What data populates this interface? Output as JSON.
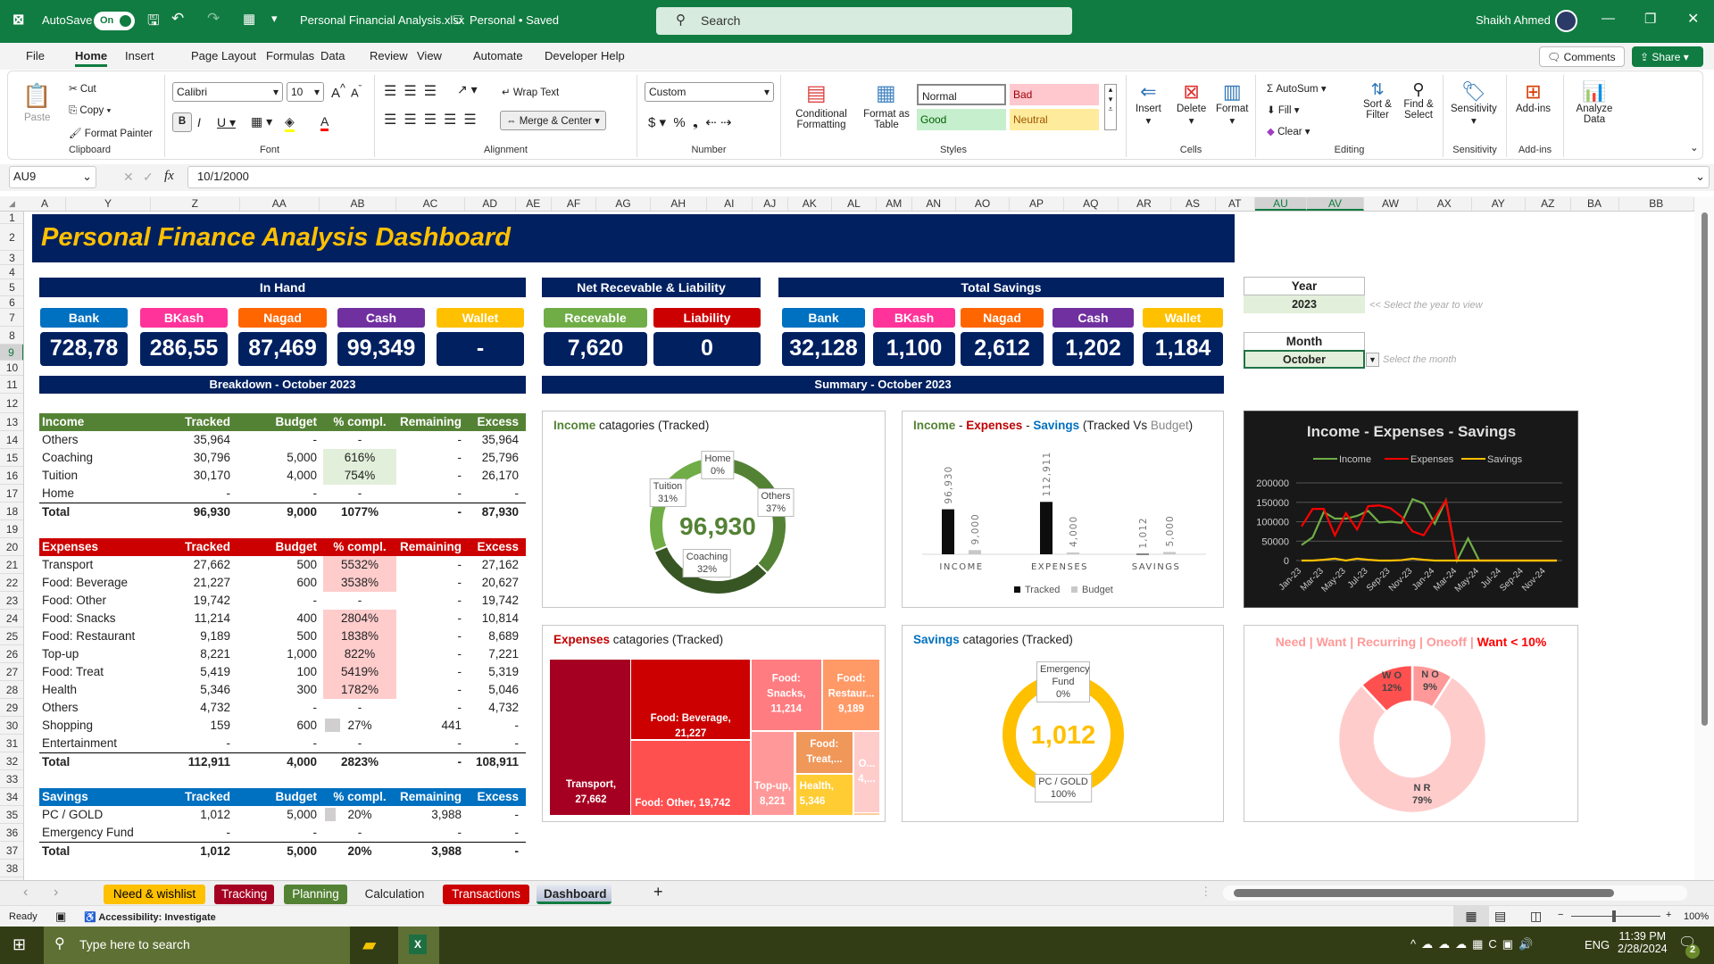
{
  "titlebar": {
    "autosave_label": "AutoSave",
    "autosave_state": "On",
    "filename": "Personal Financial Analysis.xlsx",
    "status": "Personal • Saved",
    "search_placeholder": "Search",
    "user": "Shaikh Ahmed"
  },
  "menu": {
    "tabs": [
      "File",
      "Home",
      "Insert",
      "Page Layout",
      "Formulas",
      "Data",
      "Review",
      "View",
      "Automate",
      "Developer",
      "Help"
    ],
    "active": "Home",
    "comments": "Comments",
    "share": "Share"
  },
  "ribbon": {
    "clipboard": {
      "label": "Clipboard",
      "paste": "Paste",
      "cut": "Cut",
      "copy": "Copy",
      "format_painter": "Format Painter"
    },
    "font": {
      "label": "Font",
      "name": "Calibri",
      "size": "10"
    },
    "alignment": {
      "label": "Alignment",
      "wrap": "Wrap Text",
      "merge": "Merge & Center"
    },
    "number": {
      "label": "Number",
      "format": "Custom"
    },
    "styles": {
      "label": "Styles",
      "conditional": "Conditional Formatting",
      "format_table": "Format as Table",
      "normal": "Normal",
      "bad": "Bad",
      "good": "Good",
      "neutral": "Neutral"
    },
    "cells": {
      "label": "Cells",
      "insert": "Insert",
      "delete": "Delete",
      "format": "Format"
    },
    "editing": {
      "label": "Editing",
      "autosum": "AutoSum",
      "fill": "Fill",
      "clear": "Clear",
      "sort": "Sort & Filter",
      "find": "Find & Select"
    },
    "sensitivity": {
      "label": "Sensitivity",
      "btn": "Sensitivity"
    },
    "addins": {
      "label": "Add-ins",
      "btn": "Add-ins"
    },
    "analyze": {
      "btn": "Analyze Data"
    }
  },
  "formula_bar": {
    "name_box": "AU9",
    "fx": "fx",
    "value": "10/1/2000"
  },
  "columns": [
    "A",
    "Y",
    "Z",
    "AA",
    "AB",
    "AC",
    "AD",
    "AE",
    "AF",
    "AG",
    "AH",
    "AI",
    "AJ",
    "AK",
    "AL",
    "AM",
    "AN",
    "AO",
    "AP",
    "AQ",
    "AR",
    "AS",
    "AT",
    "AU",
    "AV",
    "AW",
    "AX",
    "AY",
    "AZ",
    "BA",
    "BB"
  ],
  "selected_columns": [
    "AU",
    "AV"
  ],
  "rows": [
    "1",
    "2",
    "3",
    "4",
    "5",
    "6",
    "7",
    "8",
    "9",
    "10",
    "11",
    "12",
    "13",
    "14",
    "15",
    "16",
    "17",
    "18",
    "19",
    "20",
    "21",
    "22",
    "23",
    "24",
    "25",
    "26",
    "27",
    "28",
    "29",
    "30",
    "31",
    "32",
    "33",
    "34",
    "35",
    "36",
    "37",
    "38"
  ],
  "dashboard": {
    "title": "Personal Finance Analysis Dashboard",
    "in_hand": {
      "header": "In Hand",
      "items": [
        {
          "label": "Bank",
          "value": "728,78",
          "color": "#0070C0"
        },
        {
          "label": "BKash",
          "value": "286,55",
          "color": "#FF3399"
        },
        {
          "label": "Nagad",
          "value": "87,469",
          "color": "#FF6600"
        },
        {
          "label": "Cash",
          "value": "99,349",
          "color": "#7030A0"
        },
        {
          "label": "Wallet",
          "value": "-",
          "color": "#FFC000"
        }
      ]
    },
    "net": {
      "header": "Net Recevable & Liability",
      "items": [
        {
          "label": "Recevable",
          "value": "7,620",
          "color": "#70AD47"
        },
        {
          "label": "Liability",
          "value": "0",
          "color": "#CC0000"
        }
      ]
    },
    "savings": {
      "header": "Total Savings",
      "items": [
        {
          "label": "Bank",
          "value": "32,128",
          "color": "#0070C0"
        },
        {
          "label": "BKash",
          "value": "1,100",
          "color": "#FF3399"
        },
        {
          "label": "Nagad",
          "value": "2,612",
          "color": "#FF6600"
        },
        {
          "label": "Cash",
          "value": "1,202",
          "color": "#7030A0"
        },
        {
          "label": "Wallet",
          "value": "1,184",
          "color": "#FFC000"
        }
      ]
    },
    "breakdown_header": "Breakdown - October 2023",
    "summary_header": "Summary - October 2023",
    "year": {
      "label": "Year",
      "value": "2023",
      "hint": "<< Select the year to view"
    },
    "month": {
      "label": "Month",
      "value": "October",
      "hint": "Select the month"
    }
  },
  "tables": {
    "income": {
      "color": "#548235",
      "header": [
        "Income",
        "Tracked",
        "Budget",
        "% compl.",
        "Remaining",
        "Excess"
      ],
      "rows": [
        [
          "Others",
          "35,964",
          "-",
          "-",
          "-",
          "35,964"
        ],
        [
          "Coaching",
          "30,796",
          "5,000",
          "616%",
          "-",
          "25,796"
        ],
        [
          "Tuition",
          "30,170",
          "4,000",
          "754%",
          "-",
          "26,170"
        ],
        [
          "Home",
          "-",
          "-",
          "-",
          "-",
          "-"
        ]
      ],
      "total": [
        "Total",
        "96,930",
        "9,000",
        "1077%",
        "-",
        "87,930"
      ]
    },
    "expenses": {
      "color": "#CC0000",
      "header": [
        "Expenses",
        "Tracked",
        "Budget",
        "% compl.",
        "Remaining",
        "Excess"
      ],
      "rows": [
        [
          "Transport",
          "27,662",
          "500",
          "5532%",
          "-",
          "27,162"
        ],
        [
          "Food: Beverage",
          "21,227",
          "600",
          "3538%",
          "-",
          "20,627"
        ],
        [
          "Food: Other",
          "19,742",
          "-",
          "-",
          "-",
          "19,742"
        ],
        [
          "Food: Snacks",
          "11,214",
          "400",
          "2804%",
          "-",
          "10,814"
        ],
        [
          "Food: Restaurant",
          "9,189",
          "500",
          "1838%",
          "-",
          "8,689"
        ],
        [
          "Top-up",
          "8,221",
          "1,000",
          "822%",
          "-",
          "7,221"
        ],
        [
          "Food: Treat",
          "5,419",
          "100",
          "5419%",
          "-",
          "5,319"
        ],
        [
          "Health",
          "5,346",
          "300",
          "1782%",
          "-",
          "5,046"
        ],
        [
          "Others",
          "4,732",
          "-",
          "-",
          "-",
          "4,732"
        ],
        [
          "Shopping",
          "159",
          "600",
          "27%",
          "441",
          "-"
        ],
        [
          "Entertainment",
          "-",
          "-",
          "-",
          "-",
          "-"
        ]
      ],
      "total": [
        "Total",
        "112,911",
        "4,000",
        "2823%",
        "-",
        "108,911"
      ]
    },
    "savings": {
      "color": "#0070C0",
      "header": [
        "Savings",
        "Tracked",
        "Budget",
        "% compl.",
        "Remaining",
        "Excess"
      ],
      "rows": [
        [
          "PC / GOLD",
          "1,012",
          "5,000",
          "20%",
          "3,988",
          "-"
        ],
        [
          "Emergency Fund",
          "-",
          "-",
          "-",
          "-",
          "-"
        ]
      ],
      "total": [
        "Total",
        "1,012",
        "5,000",
        "20%",
        "3,988",
        "-"
      ]
    }
  },
  "chart_data": [
    {
      "type": "pie",
      "id": "income-donut",
      "title_parts": [
        "Income",
        " catagories (Tracked)"
      ],
      "center_value": "96,930",
      "slices": [
        {
          "name": "Others",
          "value": 35964,
          "pct": "37%",
          "color": "#548235"
        },
        {
          "name": "Coaching",
          "value": 30796,
          "pct": "32%",
          "color": "#375623"
        },
        {
          "name": "Tuition",
          "value": 30170,
          "pct": "31%",
          "color": "#70AD47"
        },
        {
          "name": "Home",
          "value": 0,
          "pct": "0%",
          "color": "#A9D08E"
        }
      ]
    },
    {
      "type": "bar",
      "id": "ies-bars",
      "title_parts": [
        "Income",
        " - ",
        "Expenses",
        " - ",
        "Savings",
        " (",
        "Tracked",
        " Vs ",
        "Budget",
        ")"
      ],
      "categories": [
        "INCOME",
        "EXPENSES",
        "SAVINGS"
      ],
      "series": [
        {
          "name": "Tracked",
          "values": [
            96930,
            112911,
            1012
          ],
          "labels": [
            "96,930",
            "112,911",
            "1,012"
          ],
          "color": "#0d0d0d"
        },
        {
          "name": "Budget",
          "values": [
            9000,
            4000,
            5000
          ],
          "labels": [
            "9,000",
            "4,000",
            "5,000"
          ],
          "color": "#c8c8c8"
        }
      ],
      "ylim": [
        0,
        250000
      ]
    },
    {
      "type": "line",
      "id": "ies-trend",
      "title": "Income - Expenses - Savings",
      "x": [
        "Jan-23",
        "Feb-23",
        "Mar-23",
        "Apr-23",
        "May-23",
        "Jun-23",
        "Jul-23",
        "Aug-23",
        "Sep-23",
        "Oct-23",
        "Nov-23",
        "Dec-23",
        "Jan-24",
        "Feb-24",
        "Mar-24",
        "Apr-24",
        "May-24",
        "Jun-24",
        "Jul-24",
        "Aug-24",
        "Sep-24",
        "Oct-24",
        "Nov-24",
        "Dec-24"
      ],
      "xticks": [
        "Jan-23",
        "Mar-23",
        "May-23",
        "Jul-23",
        "Sep-23",
        "Nov-23",
        "Jan-24",
        "Mar-24",
        "May-24",
        "Jul-24",
        "Sep-24",
        "Nov-24"
      ],
      "series": [
        {
          "name": "Income",
          "color": "#70AD47",
          "values": [
            40000,
            60000,
            125000,
            108000,
            108000,
            115000,
            128000,
            98000,
            100000,
            96930,
            158000,
            147000,
            95000,
            155000,
            0,
            57000,
            0,
            0,
            0,
            0,
            0,
            0,
            0,
            0
          ]
        },
        {
          "name": "Expenses",
          "color": "#FF0000",
          "values": [
            88000,
            133000,
            133000,
            65000,
            122000,
            80000,
            140000,
            142000,
            135000,
            112911,
            75000,
            65000,
            110000,
            155000,
            0,
            0,
            0,
            0,
            0,
            0,
            0,
            0,
            0,
            0
          ]
        },
        {
          "name": "Savings",
          "color": "#FFC000",
          "values": [
            0,
            0,
            2000,
            5000,
            0,
            5000,
            2000,
            0,
            0,
            1012,
            5000,
            2000,
            0,
            0,
            0,
            0,
            0,
            0,
            0,
            0,
            0,
            0,
            0,
            0
          ]
        }
      ],
      "yticks": [
        "0",
        "50000",
        "100000",
        "150000",
        "200000"
      ],
      "ylim": [
        0,
        200000
      ],
      "grid": true,
      "legend": "top"
    },
    {
      "type": "treemap",
      "id": "expense-treemap",
      "title_parts": [
        "Expenses",
        " catagories (Tracked)"
      ],
      "items": [
        {
          "name": "Transport",
          "value": 27662,
          "label": "Transport, 27,662",
          "color": "#A50021"
        },
        {
          "name": "Food: Beverage",
          "value": 21227,
          "label": "Food: Beverage, 21,227",
          "color": "#CC0000"
        },
        {
          "name": "Food: Other",
          "value": 19742,
          "label": "Food: Other,  19,742",
          "color": "#FF5050"
        },
        {
          "name": "Food: Snacks",
          "value": 11214,
          "label": "Food: Snacks, 11,214",
          "color": "#FF7C80"
        },
        {
          "name": "Food: Restaurant",
          "value": 9189,
          "label": "Food: Restaur... 9,189",
          "color": "#FF9966"
        },
        {
          "name": "Top-up",
          "value": 8221,
          "label": "Top-up, 8,221",
          "color": "#FF9999"
        },
        {
          "name": "Food: Treat",
          "value": 5419,
          "label": "Food: Treat,...",
          "color": "#F0975A"
        },
        {
          "name": "Health",
          "value": 5346,
          "label": "Health, 5,346",
          "color": "#FFCC33"
        },
        {
          "name": "Others",
          "value": 4732,
          "label": "O... 4,...",
          "color": "#FFCCCC"
        },
        {
          "name": "Shopping",
          "value": 159,
          "label": "",
          "color": "#FFCC99"
        }
      ]
    },
    {
      "type": "pie",
      "id": "savings-donut",
      "title_parts": [
        "Savings",
        " catagories (Tracked)"
      ],
      "center_value": "1,012",
      "slices": [
        {
          "name": "Emergency Fund",
          "value": 0,
          "pct": "0%",
          "color": "#FFC000"
        },
        {
          "name": "PC / GOLD",
          "value": 1012,
          "pct": "100%",
          "color": "#FFC000"
        }
      ]
    },
    {
      "type": "pie",
      "id": "need-want-donut",
      "title_parts": [
        "Need | Want | Recurring | Oneoff | ",
        "Want < 10%"
      ],
      "slices": [
        {
          "name": "N O",
          "value": 9,
          "pct": "9%",
          "color": "#FF9999"
        },
        {
          "name": "N R",
          "value": 79,
          "pct": "79%",
          "color": "#FFCCCC"
        },
        {
          "name": "W O",
          "value": 12,
          "pct": "12%",
          "color": "#FF5050"
        }
      ]
    }
  ],
  "sheet_tabs": [
    {
      "label": "Need & wishlist",
      "color": "#FFC000",
      "text": "#000"
    },
    {
      "label": "Tracking",
      "color": "#A50021",
      "text": "#fff"
    },
    {
      "label": "Planning",
      "color": "#548235",
      "text": "#fff"
    },
    {
      "label": "Calculation",
      "color": "",
      "text": "#222"
    },
    {
      "label": "Transactions",
      "color": "#CC0000",
      "text": "#fff"
    },
    {
      "label": "Dashboard",
      "color": "#c9d0e0",
      "text": "#222",
      "active": true
    }
  ],
  "status": {
    "ready": "Ready",
    "accessibility": "Accessibility: Investigate",
    "zoom": "100%"
  },
  "taskbar": {
    "search_placeholder": "Type here to search",
    "lang": "ENG",
    "time": "11:39 PM",
    "date": "2/28/2024",
    "notifications": "2"
  }
}
